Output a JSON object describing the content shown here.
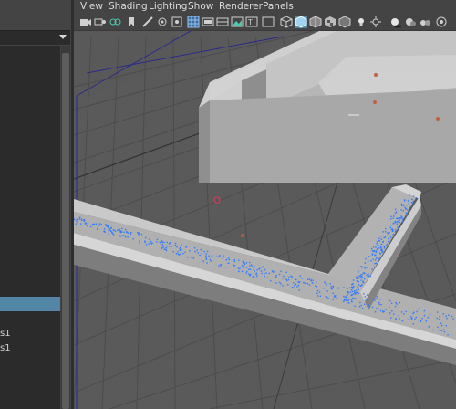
{
  "menubar": {
    "items": [
      "View",
      "Shading",
      "Lighting",
      "Show",
      "Renderer",
      "Panels"
    ]
  },
  "toolbar": {
    "icons": [
      "camera-icon",
      "bookmark-icon",
      "grid-icon",
      "wireframe-icon",
      "smooth-shade-icon",
      "textured-icon",
      "lighting-icon",
      "shadow-icon",
      "xray-icon",
      "isolate-icon",
      "snapshot-icon",
      "light-icon",
      "hud-icon"
    ]
  },
  "outliner": {
    "rows": [
      {
        "label": "s1"
      },
      {
        "label": "s1"
      }
    ]
  },
  "colors": {
    "panel_bg": "#444444",
    "list_bg": "#2b2b2b",
    "selection": "#5285a6",
    "grid_bg": "#5a5a5a",
    "particles": "#2f7bff"
  }
}
